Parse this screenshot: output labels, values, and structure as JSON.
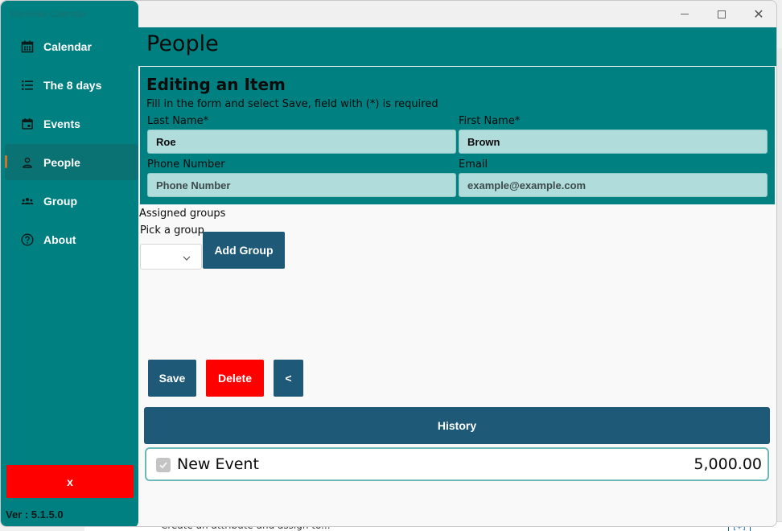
{
  "window": {
    "app_title": "Bamileke Calendar",
    "close_glyph": "✕"
  },
  "sidebar": {
    "items": [
      {
        "label": "Calendar",
        "icon": "calendar-icon"
      },
      {
        "label": "The 8 days",
        "icon": "list-icon"
      },
      {
        "label": "Events",
        "icon": "event-icon"
      },
      {
        "label": "People",
        "icon": "person-icon",
        "active": true
      },
      {
        "label": "Group",
        "icon": "group-icon"
      },
      {
        "label": "About",
        "icon": "help-circle-icon"
      }
    ],
    "close_label": "x",
    "version": "Ver : 5.1.5.0"
  },
  "page": {
    "title": "People"
  },
  "form": {
    "title": "Editing an Item",
    "subtitle": "Fill in the form and select Save, field with (*) is required",
    "last_name": {
      "label": "Last Name*",
      "value": "Roe"
    },
    "first_name": {
      "label": "First Name*",
      "value": "Brown"
    },
    "phone": {
      "label": "Phone Number",
      "placeholder": "Phone Number"
    },
    "email": {
      "label": "Email",
      "placeholder": "example@example.com"
    }
  },
  "groups": {
    "label": "Assigned groups",
    "pick_label": "Pick a group",
    "selected": "",
    "add_label": "Add Group"
  },
  "actions": {
    "save_label": "Save",
    "delete_label": "Delete",
    "back_label": "<"
  },
  "history": {
    "label": "History",
    "items": [
      {
        "name": "New Event",
        "amount": "5,000.00",
        "checked": true
      }
    ]
  },
  "background": {
    "partial_text": "Create an attribute and assign to..."
  },
  "colors": {
    "teal": "#008080",
    "button_blue": "#1e5a78",
    "danger_red": "#ff0000",
    "input_fill": "#b0dcdc"
  }
}
